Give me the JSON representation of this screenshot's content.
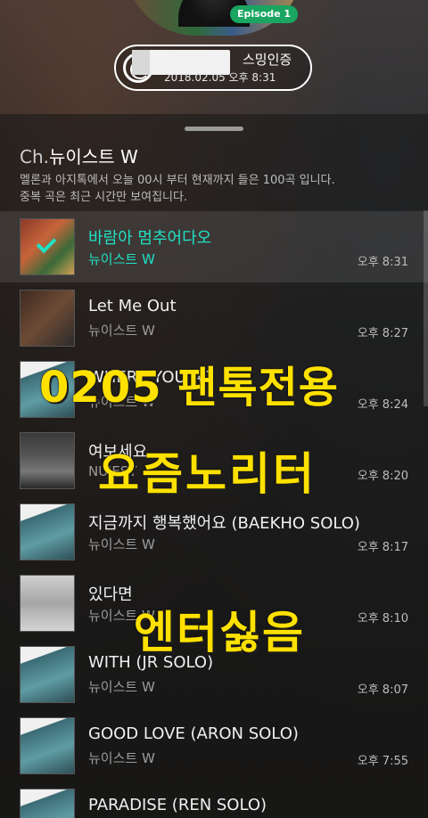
{
  "top": {
    "badge": "Episode 1",
    "verify_label": "스밍인증",
    "verify_date": "2018.02.05 오후 8:31"
  },
  "header": {
    "ch_prefix": "Ch.",
    "channel_name": "뉴이스트 W",
    "desc_line1": "멜론과 아지톡에서 오늘 00시 부터 현재까지 들은 100곡 입니다.",
    "desc_line2": "중복 곡은 최근 시간만 보여집니다."
  },
  "songs": [
    {
      "title": "바람아 멈추어다오",
      "artist": "뉴이스트 W",
      "time": "오후 8:31",
      "active": true
    },
    {
      "title": "Let Me Out",
      "artist": "뉴이스트 W",
      "time": "오후 8:27"
    },
    {
      "title": "WHERE YOU AT",
      "artist": "뉴이스트 W",
      "time": "오후 8:24"
    },
    {
      "title": "여보세요",
      "artist": "NU'EST",
      "time": "오후 8:20"
    },
    {
      "title": "지금까지 행복했어요 (BAEKHO SOLO)",
      "artist": "뉴이스트 W",
      "time": "오후 8:17"
    },
    {
      "title": "있다면",
      "artist": "뉴이스트 W",
      "time": "오후 8:10"
    },
    {
      "title": "WITH (JR SOLO)",
      "artist": "뉴이스트 W",
      "time": "오후 8:07"
    },
    {
      "title": "GOOD LOVE (ARON SOLO)",
      "artist": "뉴이스트 W",
      "time": "오후 7:55"
    },
    {
      "title": "PARADISE (REN SOLO)",
      "artist": "",
      "time": ""
    }
  ],
  "overlay": {
    "line1": "0205 팬톡전용",
    "line2": "요즘노리터",
    "line3": "엔터싫음"
  },
  "colors": {
    "accent": "#1fe0c4",
    "overlay": "#ffe100"
  }
}
